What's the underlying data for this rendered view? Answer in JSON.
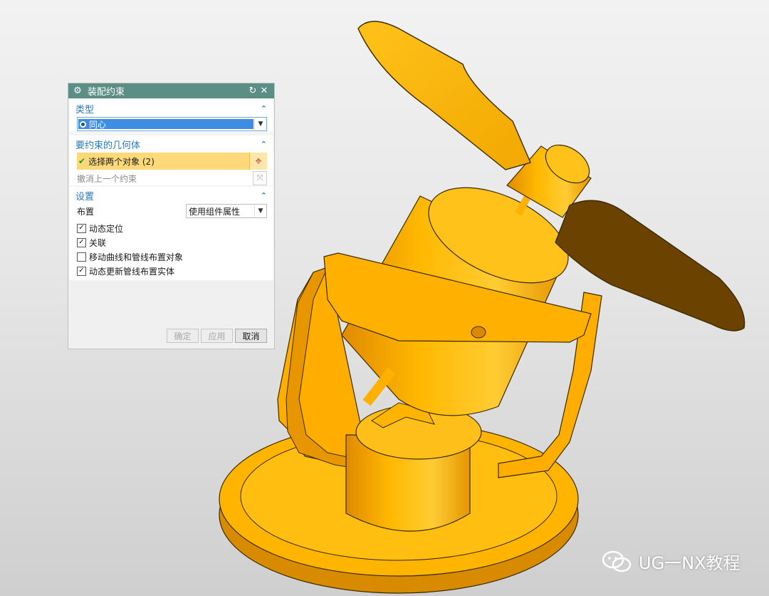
{
  "dialog": {
    "title": "装配约束",
    "type_section": {
      "heading": "类型",
      "selected": "同心"
    },
    "geometry_section": {
      "heading": "要约束的几何体",
      "select_objects": "选择两个对象 (2)",
      "undo_last": "撤消上一个约束"
    },
    "settings_section": {
      "heading": "设置",
      "layout_label": "布置",
      "layout_value": "使用组件属性",
      "checkboxes": [
        {
          "label": "动态定位",
          "checked": true
        },
        {
          "label": "关联",
          "checked": true
        },
        {
          "label": "移动曲线和管线布置对象",
          "checked": false
        },
        {
          "label": "动态更新管线布置实体",
          "checked": true
        }
      ]
    },
    "buttons": {
      "ok": "确定",
      "apply": "应用",
      "cancel": "取消"
    }
  },
  "watermark": {
    "text": "UG一NX教程"
  },
  "colors": {
    "titlebar": "#5b8f86",
    "section_heading": "#2c78b6",
    "selection_highlight": "#fdd97a",
    "model_orange": "#ffb400"
  }
}
